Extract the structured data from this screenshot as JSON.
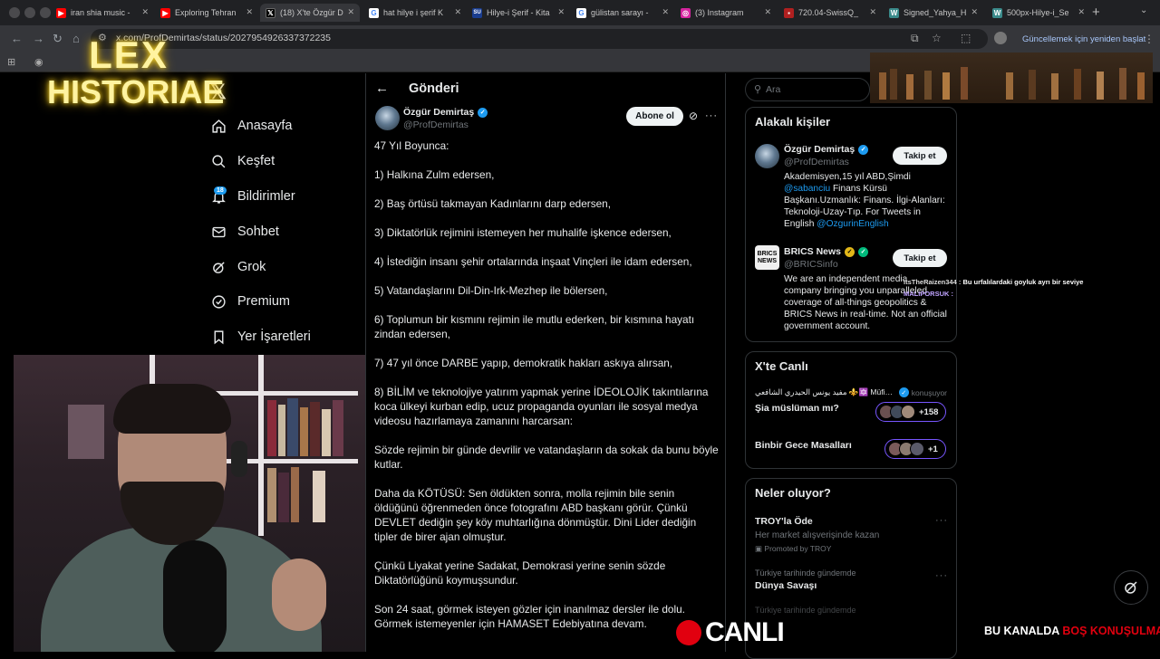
{
  "browser": {
    "tabs": [
      {
        "label": "iran shia music -",
        "icon": "youtube-icon",
        "color": "#ff0000"
      },
      {
        "label": "Exploring Tehran",
        "icon": "youtube-icon",
        "color": "#ff0000"
      },
      {
        "label": "(18) X'te Özgür D",
        "icon": "x-icon",
        "color": "#000000"
      },
      {
        "label": "hat hilye i şerif K",
        "icon": "google-icon",
        "color": "#4285f4"
      },
      {
        "label": "Hilye-i Şerif - Kita",
        "icon": "su-icon",
        "color": "#1a3d8f"
      },
      {
        "label": "gülistan sarayı -",
        "icon": "google-icon",
        "color": "#4285f4"
      },
      {
        "label": "(3) Instagram",
        "icon": "instagram-icon",
        "color": "#d6249f"
      },
      {
        "label": "720.04-SwissQ_",
        "icon": "pdf-icon",
        "color": "#b02020"
      },
      {
        "label": "Signed_Yahya_H",
        "icon": "wiki-icon",
        "color": "#3a8a8a"
      },
      {
        "label": "500px-Hilye-i_Se",
        "icon": "wiki-icon",
        "color": "#3a8a8a"
      }
    ],
    "url": "x.com/ProfDemirtas/status/2027954926337372235",
    "update_label": "Güncellemek için yeniden başlat"
  },
  "overlay": {
    "logo_line1": "LEX",
    "logo_line2": "HISTORIAE",
    "live_label": "CANLI",
    "ticker_white": "BU KANALDA ",
    "ticker_red": "BOŞ KONUŞULMAKTA",
    "chat_user": "ItsTheRaizen344 :",
    "chat_msg": "Bu urfalılardaki goyluk ayrı bir seviye",
    "chat2_user": "MALIPORSUK :"
  },
  "nav": {
    "badge": "18",
    "items": [
      {
        "label": "Anasayfa",
        "icon": "home-icon"
      },
      {
        "label": "Keşfet",
        "icon": "search-icon"
      },
      {
        "label": "Bildirimler",
        "icon": "bell-icon"
      },
      {
        "label": "Sohbet",
        "icon": "mail-icon"
      },
      {
        "label": "Grok",
        "icon": "grok-icon"
      },
      {
        "label": "Premium",
        "icon": "premium-icon"
      },
      {
        "label": "Yer İşaretleri",
        "icon": "bookmark-icon"
      }
    ]
  },
  "post": {
    "header": "Gönderi",
    "author_name": "Özgür Demirtaş",
    "author_handle": "@ProfDemirtas",
    "subscribe_label": "Abone ol",
    "paragraphs": [
      "47 Yıl Boyunca:",
      "1) Halkına Zulm edersen,",
      "2) Baş örtüsü takmayan Kadınlarını darp edersen,",
      "3) Diktatörlük rejimini istemeyen her muhalife işkence edersen,",
      "4) İstediğin insanı şehir ortalarında inşaat Vinçleri ile idam edersen,",
      "5) Vatandaşlarını Dil-Din-Irk-Mezhep ile bölersen,",
      "6) Toplumun bir kısmını rejimin ile mutlu ederken, bir kısmına hayatı zindan edersen,",
      "7) 47 yıl önce DARBE yapıp, demokratik hakları askıya alırsan,",
      "8) BİLİM ve teknolojiye yatırım yapmak yerine İDEOLOJİK takıntılarına koca ülkeyi kurban edip, ucuz propaganda oyunları ile sosyal medya videosu hazırlamaya zamanını harcarsan:",
      "Sözde rejimin bir günde devrilir ve vatandaşların da sokak da bunu böyle kutlar.",
      "Daha da KÖTÜSÜ: Sen öldükten sonra, molla rejimin bile senin öldüğünü öğrenmeden önce fotografını ABD başkanı görür. Çünkü DEVLET dediğin şey köy muhtarlığına dönmüştür. Dini Lider dediğin tipler de birer ajan olmuştur.",
      "Çünkü Liyakat yerine Sadakat, Demokrasi yerine senin sözde Diktatörlüğünü koymuşsundur.",
      "Son 24 saat, görmek isteyen gözler için inanılmaz dersler ile dolu.\nGörmek istemeyenler için HAMASET Edebiyatına devam."
    ]
  },
  "sidebar": {
    "search_placeholder": "Ara",
    "related_title": "Alakalı kişiler",
    "follow_label": "Takip et",
    "people": [
      {
        "name": "Özgür Demirtaş",
        "handle": "@ProfDemirtas",
        "bio_a": "Akademisyen,15 yıl ABD,Şimdi",
        "bio_link1": "@sabanciu",
        "bio_b": " Finans Kürsü Başkanı.Uzmanlık: Finans. İlgi-Alanları: Teknoloji-Uzay-Tıp. For Tweets in English ",
        "bio_link2": "@OzgurinEnglish"
      },
      {
        "name": "BRICS News",
        "handle": "@BRICSinfo",
        "logo_text": "BRICS NEWS",
        "bio": "We are an independent media company bringing you unparalleled coverage of all-things geopolitics & BRICS News in real-time. Not an official government account."
      }
    ],
    "live_title": "X'te Canlı",
    "live_items": [
      {
        "host": "مفيد يونس الحيدري الشافعي ⚜️🔯 Müfid ...",
        "status": "konuşuyor",
        "topic": "Şia müslüman mı?",
        "count": "+158"
      },
      {
        "host": "",
        "status": "",
        "topic": "Binbir Gece Masalları",
        "count": "+1"
      }
    ],
    "trends_title": "Neler oluyor?",
    "trends": [
      {
        "title": "TROY'la Öde",
        "desc": "Her market alışverişinde kazan",
        "promo": "Promoted by TROY"
      },
      {
        "context": "Türkiye tarihinde gündemde",
        "title": "Dünya Savaşı"
      },
      {
        "context": "Türkiye tarihinde gündemde"
      }
    ]
  }
}
